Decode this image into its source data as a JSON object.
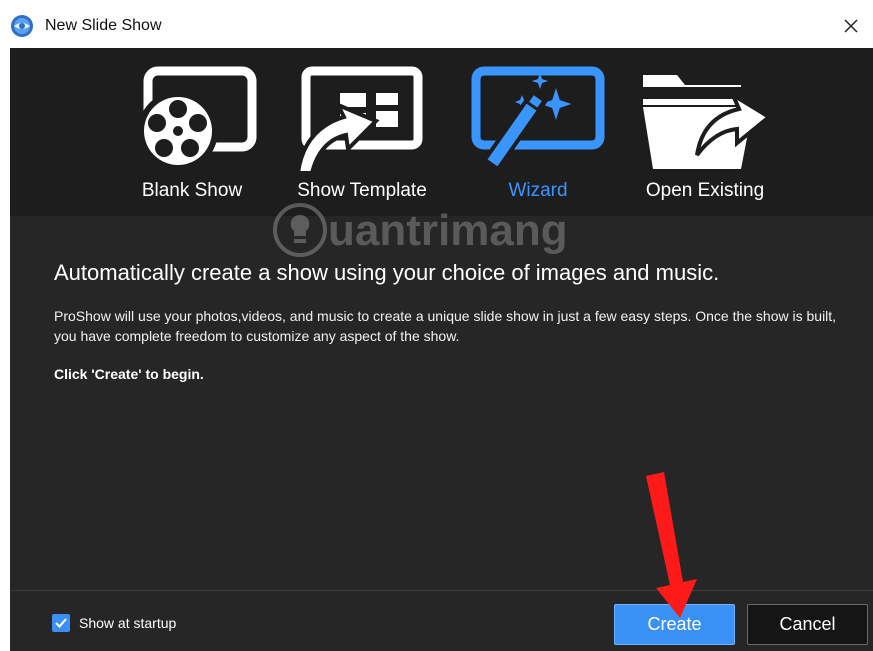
{
  "window": {
    "title": "New Slide Show",
    "close_icon": "close-icon",
    "app_icon": "proshow-globe-icon"
  },
  "modes": [
    {
      "label": "Blank Show",
      "icon": "film-reel-icon",
      "active": false
    },
    {
      "label": "Show Template",
      "icon": "template-arrow-icon",
      "active": false
    },
    {
      "label": "Wizard",
      "icon": "magic-wand-icon",
      "active": true
    },
    {
      "label": "Open Existing",
      "icon": "open-folder-icon",
      "active": false
    }
  ],
  "content": {
    "headline": "Automatically create a show using your choice of images and music.",
    "description": "ProShow will use your photos,videos, and music to create a unique slide show in just a few easy steps. Once the show is built, you have complete freedom to customize any aspect of the show.",
    "cta": "Click 'Create' to begin."
  },
  "footer": {
    "show_at_startup_label": "Show at startup",
    "show_at_startup_checked": true,
    "create_label": "Create",
    "cancel_label": "Cancel"
  },
  "watermark": {
    "text": "uantrimang"
  },
  "colors": {
    "accent": "#3b95ff",
    "background": "#262626",
    "annotation": "#ff1a1a"
  }
}
